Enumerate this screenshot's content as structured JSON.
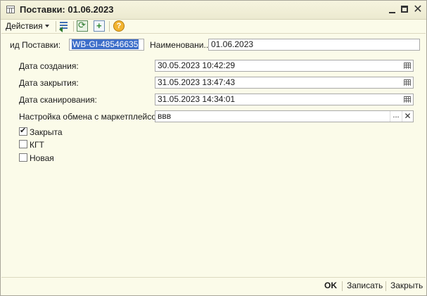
{
  "window": {
    "title": "Поставки: 01.06.2023"
  },
  "toolbar": {
    "actions_label": "Действия",
    "icons": [
      "list-back-icon",
      "refresh-icon",
      "add-copy-icon",
      "help-icon"
    ]
  },
  "form": {
    "id_label": "ид Поставки:",
    "id_value": "WB-GI-48546635",
    "name_label": "Наименовани...",
    "name_value": "01.06.2023",
    "created_label": "Дата создания:",
    "created_value": "30.05.2023 10:42:29",
    "closed_label": "Дата закрытия:",
    "closed_value": "31.05.2023 13:47:43",
    "scanned_label": "Дата сканирования:",
    "scanned_value": "31.05.2023 14:34:01",
    "exchange_label": "Настройка обмена с маркетплейсо...",
    "exchange_value": "ввв",
    "checkboxes": [
      {
        "label": "Закрыта",
        "checked": true
      },
      {
        "label": "КГТ",
        "checked": false
      },
      {
        "label": "Новая",
        "checked": false
      }
    ]
  },
  "footer": {
    "ok_label": "OK",
    "save_label": "Записать",
    "close_label": "Закрыть"
  }
}
